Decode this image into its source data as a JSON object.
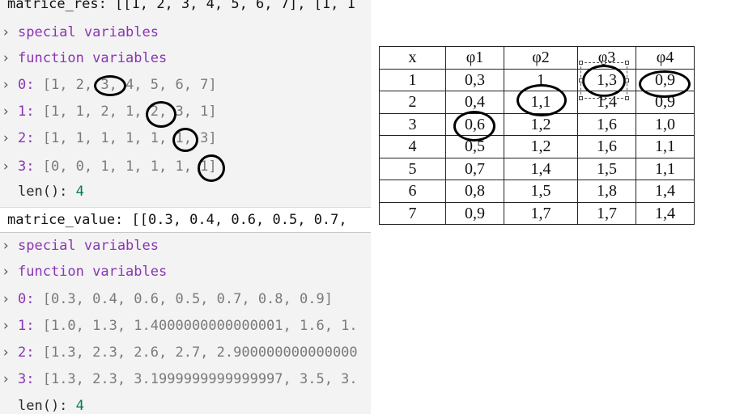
{
  "debug": {
    "res": {
      "header": "matrice_res: [[1, 2, 3, 4, 5, 6, 7], [1, 1",
      "special": "special variables",
      "function": "function variables",
      "rows": [
        {
          "key": "0: ",
          "value": "[1, 2, 3, 4, 5, 6, 7]"
        },
        {
          "key": "1: ",
          "value": "[1, 1, 2, 1, 2, 3, 1]"
        },
        {
          "key": "2: ",
          "value": "[1, 1, 1, 1, 1, 1, 3]"
        },
        {
          "key": "3: ",
          "value": "[0, 0, 1, 1, 1, 1, 1]"
        }
      ],
      "len_label": "len(): ",
      "len_value": "4"
    },
    "value": {
      "header": "matrice_value: [[0.3, 0.4, 0.6, 0.5, 0.7,",
      "special": "special variables",
      "function": "function variables",
      "rows": [
        {
          "key": "0: ",
          "value": "[0.3, 0.4, 0.6, 0.5, 0.7, 0.8, 0.9]"
        },
        {
          "key": "1: ",
          "value": "[1.0, 1.3, 1.4000000000000001, 1.6, 1."
        },
        {
          "key": "2: ",
          "value": "[1.3, 2.3, 2.6, 2.7, 2.900000000000000"
        },
        {
          "key": "3: ",
          "value": "[1.3, 2.3, 3.1999999999999997, 3.5, 3."
        }
      ],
      "len_label": "len(): ",
      "len_value": "4"
    }
  },
  "table": {
    "headers": [
      "x",
      "φ1",
      "φ2",
      "φ3",
      "φ4"
    ],
    "rows": [
      [
        "1",
        "0,3",
        "1",
        "1,3",
        "0,9"
      ],
      [
        "2",
        "0,4",
        "1,1",
        "1,4",
        "0,9"
      ],
      [
        "3",
        "0,6",
        "1,2",
        "1,6",
        "1,0"
      ],
      [
        "4",
        "0,5",
        "1,2",
        "1,6",
        "1,1"
      ],
      [
        "5",
        "0,7",
        "1,4",
        "1,5",
        "1,1"
      ],
      [
        "6",
        "0,8",
        "1,5",
        "1,8",
        "1,4"
      ],
      [
        "7",
        "0,9",
        "1,7",
        "1,7",
        "1,4"
      ]
    ]
  },
  "icons": {
    "expand": "chevron-right-icon"
  }
}
